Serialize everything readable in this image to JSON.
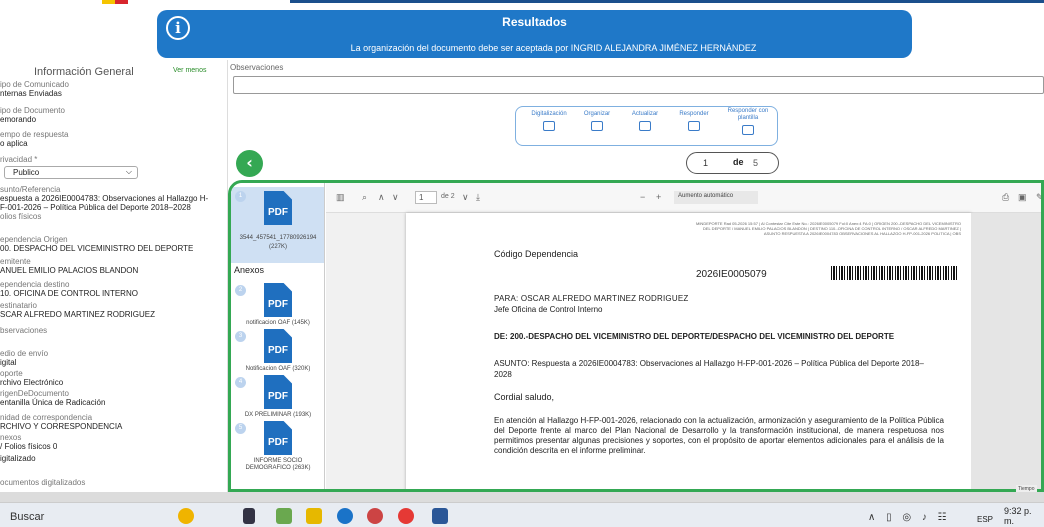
{
  "banner": {
    "title": "Resultados",
    "message": "La organización del documento debe ser aceptada por INGRID ALEJANDRA JIMÉNEZ HERNÁNDEZ"
  },
  "sidebar": {
    "title": "Información General",
    "toggle": "Ver menos",
    "fields": [
      {
        "label": "ipo de Comunicado",
        "value": "nternas Enviadas"
      },
      {
        "label": "ipo de Documento",
        "value": "emorando"
      },
      {
        "label": "empo de respuesta",
        "value": "o aplica"
      },
      {
        "label": "rivacidad *",
        "value": ""
      },
      {
        "label": "sunto/Referencia",
        "value": "espuesta a 2026IE0004783: Observaciones al Hallazgo H-\nF-001-2026 – Política Pública del Deporte 2018–2028"
      },
      {
        "label": "olios físicos",
        "value": ""
      },
      {
        "label": "ependencia Origen",
        "value": "00. DESPACHO DEL VICEMINISTRO DEL DEPORTE"
      },
      {
        "label": "emitente",
        "value": "ANUEL EMILIO PALACIOS BLANDON"
      },
      {
        "label": "ependencia destino",
        "value": "10. OFICINA DE CONTROL INTERNO"
      },
      {
        "label": "estinatario",
        "value": "SCAR ALFREDO MARTINEZ RODRIGUEZ"
      },
      {
        "label": "bservaciones",
        "value": ""
      },
      {
        "label": "edio de envío",
        "value": "igital"
      },
      {
        "label": "oporte",
        "value": "rchivo Electrónico"
      },
      {
        "label": "rigenDeDocumento",
        "value": "entanilla Única de Radicación"
      },
      {
        "label": "nidad de correspondencia",
        "value": "RCHIVO Y CORRESPONDENCIA"
      },
      {
        "label": "nexos",
        "value": "/ Folios físicos 0"
      },
      {
        "label": "",
        "value": "igitalizado"
      },
      {
        "label": "ocumentos digitalizados",
        "value": ""
      }
    ],
    "privacy_value": "Publico"
  },
  "observaciones": {
    "label": "Observaciones",
    "value": ""
  },
  "toolbar": {
    "items": [
      "Digitalización",
      "Organizar",
      "Actualizar",
      "Responder",
      "Responder con plantilla"
    ]
  },
  "pager": {
    "current": "1",
    "de": "de",
    "total": "5"
  },
  "attachments": {
    "main": {
      "num": "1",
      "name": "3544_457541_17780926194",
      "size": "(227K)"
    },
    "anexos_label": "Anexos",
    "items": [
      {
        "num": "2",
        "name": "notificacion OAF (145K)"
      },
      {
        "num": "3",
        "name": "Notificacion OAF (320K)"
      },
      {
        "num": "4",
        "name": "DX PRELIMINAR (193K)"
      },
      {
        "num": "5",
        "name": "INFORME SOCIO DEMOGRAFICO (263K)"
      }
    ],
    "icon_text": "PDF"
  },
  "pdfviewer": {
    "page_input": "1",
    "page_count": "de 2",
    "zoom": "Aumento automático"
  },
  "document": {
    "code_label": "Código Dependencia",
    "radicado": "2026IE0005079",
    "stamp": "MINDEPORTE Rad 05-2026 15:57 | Al Contestar Cite Este No.: 2026IE0005079 Fol:0 Anex:4 FA:0 | ORIGEN 200.-DESPACHO DEL VICEMINISTRO DEL DEPORTE / MANUEL EMILIO PALACIOS BLANDON | DESTINO 110.-OFICINA DE CONTROL INTERNO / OSCAR ALFREDO MARTINEZ | ASUNTO RESPUESTA A 2026IE0004783 OBSERVACIONES AL HALLAZGO H-FP-001-2026 POLITICA | OBS",
    "para": "PARA: OSCAR ALFREDO MARTINEZ RODRIGUEZ",
    "para_role": "Jefe Oficina de Control Interno",
    "de": "DE: 200.-DESPACHO DEL VICEMINISTRO DEL DEPORTE/DESPACHO DEL VICEMINISTRO DEL DEPORTE",
    "asunto": "ASUNTO: Respuesta a 2026IE0004783: Observaciones al Hallazgo H-FP-001-2026 – Política Pública del Deporte 2018–2028",
    "saludo": "Cordial saludo,",
    "body": "En atención al Hallazgo H-FP-001-2026, relacionado con la actualización, armonización y aseguramiento de la Política Pública del Deporte frente al marco del Plan Nacional de Desarrollo y la transformación institucional, de manera respetuosa nos permitimos presentar algunas precisiones y soportes, con el propósito de aportar elementos adicionales para el análisis de la condición descrita en el informe preliminar."
  },
  "status_tag": "Tiempo",
  "taskbar": {
    "search": "Buscar",
    "lang": "ESP",
    "time": "9:32 p. m."
  }
}
